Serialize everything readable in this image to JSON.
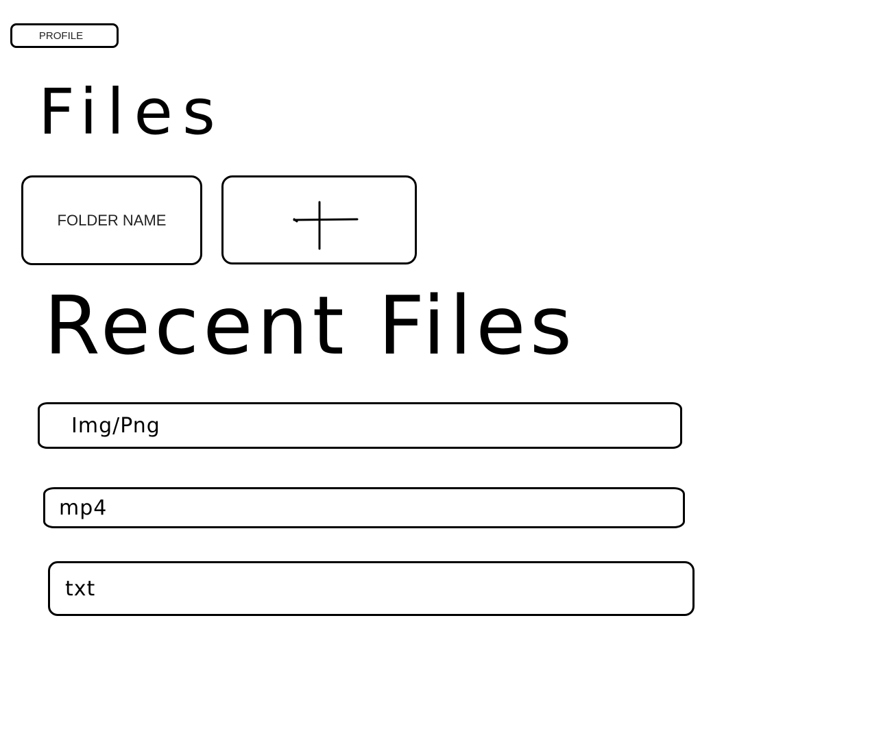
{
  "header": {
    "profile_label": "PROFILE"
  },
  "files_section": {
    "title": "Files",
    "folders": [
      {
        "name": "FOLDER NAME"
      }
    ],
    "add_folder_icon": "plus-icon"
  },
  "recent_section": {
    "title": "Recent Files",
    "items": [
      {
        "label": "Img/Png"
      },
      {
        "label": "mp4"
      },
      {
        "label": "txt"
      }
    ]
  },
  "colors": {
    "stroke": "#000000",
    "background": "#ffffff"
  }
}
